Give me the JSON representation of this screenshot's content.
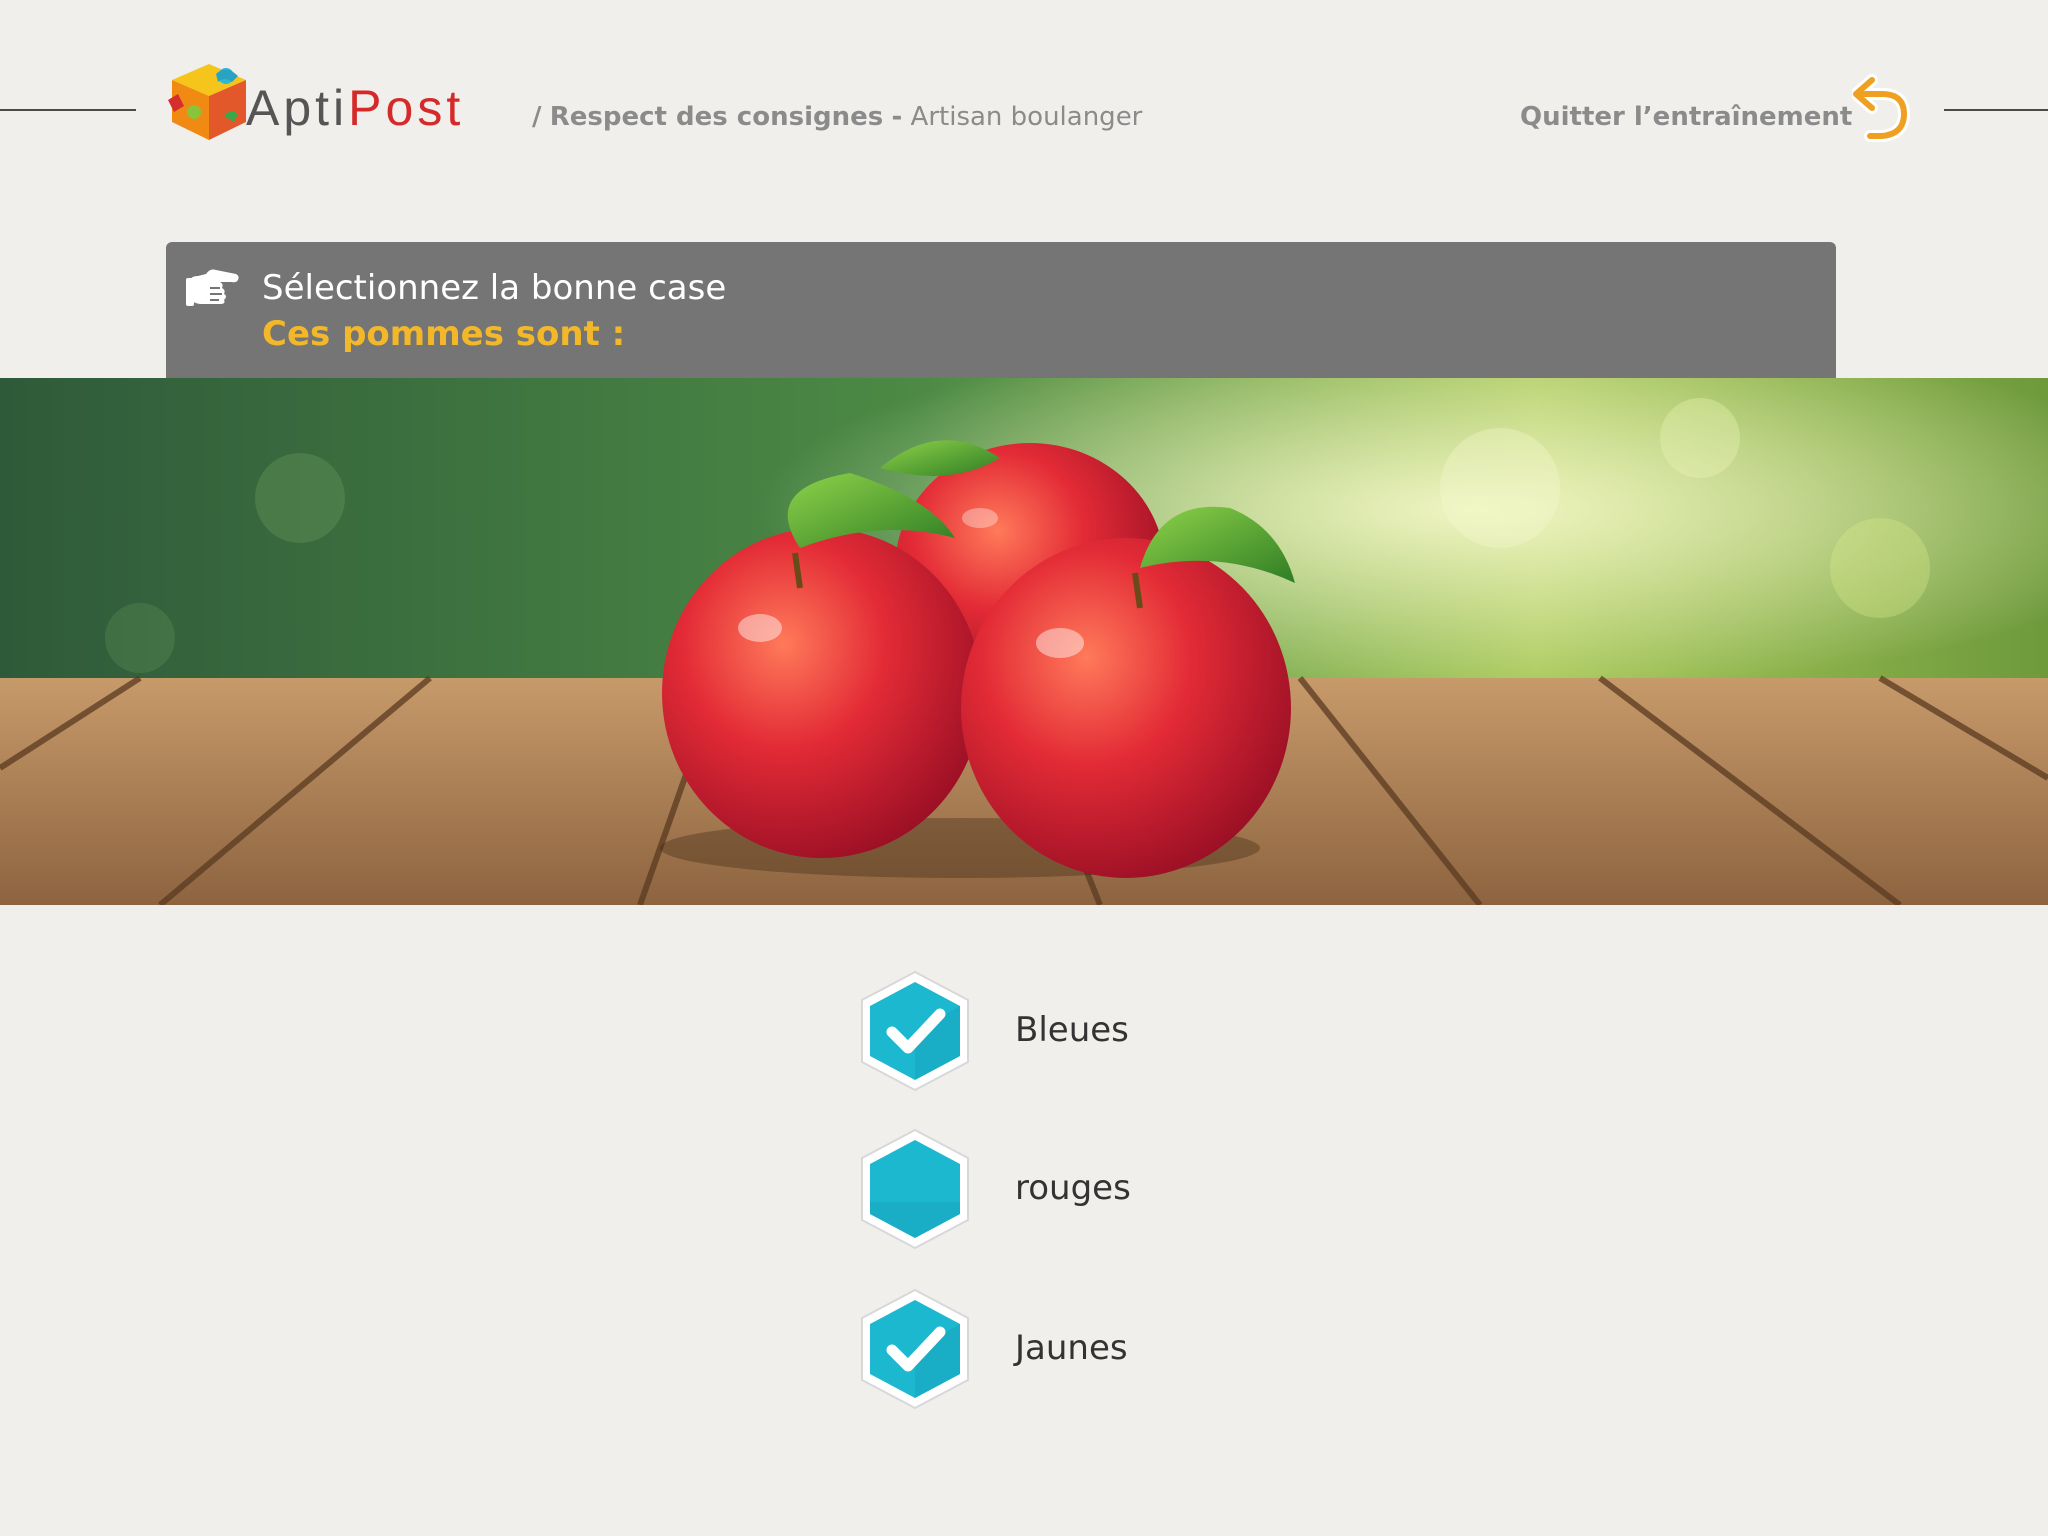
{
  "app": {
    "logo_text_part1": "Apti",
    "logo_text_part2": "Post"
  },
  "header": {
    "breadcrumb_separator": "/",
    "breadcrumb_section": "Respect des consignes",
    "breadcrumb_dash": "-",
    "breadcrumb_job": "Artisan boulanger",
    "quit_label": "Quitter l’entraînement"
  },
  "instruction": {
    "title": "Sélectionnez la bonne case",
    "question": "Ces pommes sont :"
  },
  "options": [
    {
      "label": "Bleues",
      "checked": true
    },
    {
      "label": "rouges",
      "checked": false
    },
    {
      "label": "Jaunes",
      "checked": true
    }
  ],
  "colors": {
    "background": "#f0efeb",
    "instruction_bar": "#757575",
    "question_text": "#f2b82a",
    "option_teal": "#1bb8d0",
    "logo_red": "#d42a2a",
    "quit_arrow": "#f0a020"
  },
  "icons": {
    "logo": "puzzle-cube-icon",
    "quit": "undo-arrow-icon",
    "instruction": "pointing-hand-icon",
    "option_checked": "hexagon-check-icon",
    "option_unchecked": "hexagon-icon"
  }
}
